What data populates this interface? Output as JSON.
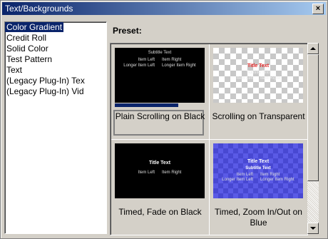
{
  "window": {
    "title": "Text/Backgrounds",
    "close_glyph": "×"
  },
  "sidebar": {
    "items": [
      {
        "label": "Color Gradient",
        "selected": true
      },
      {
        "label": "Credit Roll"
      },
      {
        "label": "Solid Color"
      },
      {
        "label": "Test Pattern"
      },
      {
        "label": "Text"
      },
      {
        "label": "(Legacy Plug-In) Tex"
      },
      {
        "label": "(Legacy Plug-In) Vid"
      }
    ]
  },
  "preset": {
    "label": "Preset:",
    "tiles": [
      {
        "caption": "Plain Scrolling on Black",
        "selected": true,
        "progress_percent": 71,
        "thumb": {
          "style": "black",
          "lines": [
            "Subtitle Text",
            "Item Left",
            "Item Right",
            "Longer Item Left",
            "Longer Item Right"
          ]
        }
      },
      {
        "caption": "Scrolling on Transparent",
        "thumb": {
          "style": "checker",
          "lines": [
            "Title Text",
            "Subtitle Text",
            "Item Left",
            "Item Right"
          ]
        }
      },
      {
        "caption": "Timed, Fade on Black",
        "thumb": {
          "style": "black",
          "lines": [
            "Title Text",
            "Item Left",
            "Item Right"
          ]
        }
      },
      {
        "caption": "Timed, Zoom In/Out on Blue",
        "thumb": {
          "style": "blue",
          "lines": [
            "Title Text",
            "Subtitle Text",
            "Item Left",
            "Item Right",
            "Longer Item Left",
            "Longer Item Right"
          ]
        }
      }
    ]
  },
  "colors": {
    "title_bar": "#0a246a",
    "selection": "#0a246a",
    "face": "#d4d0c8"
  }
}
